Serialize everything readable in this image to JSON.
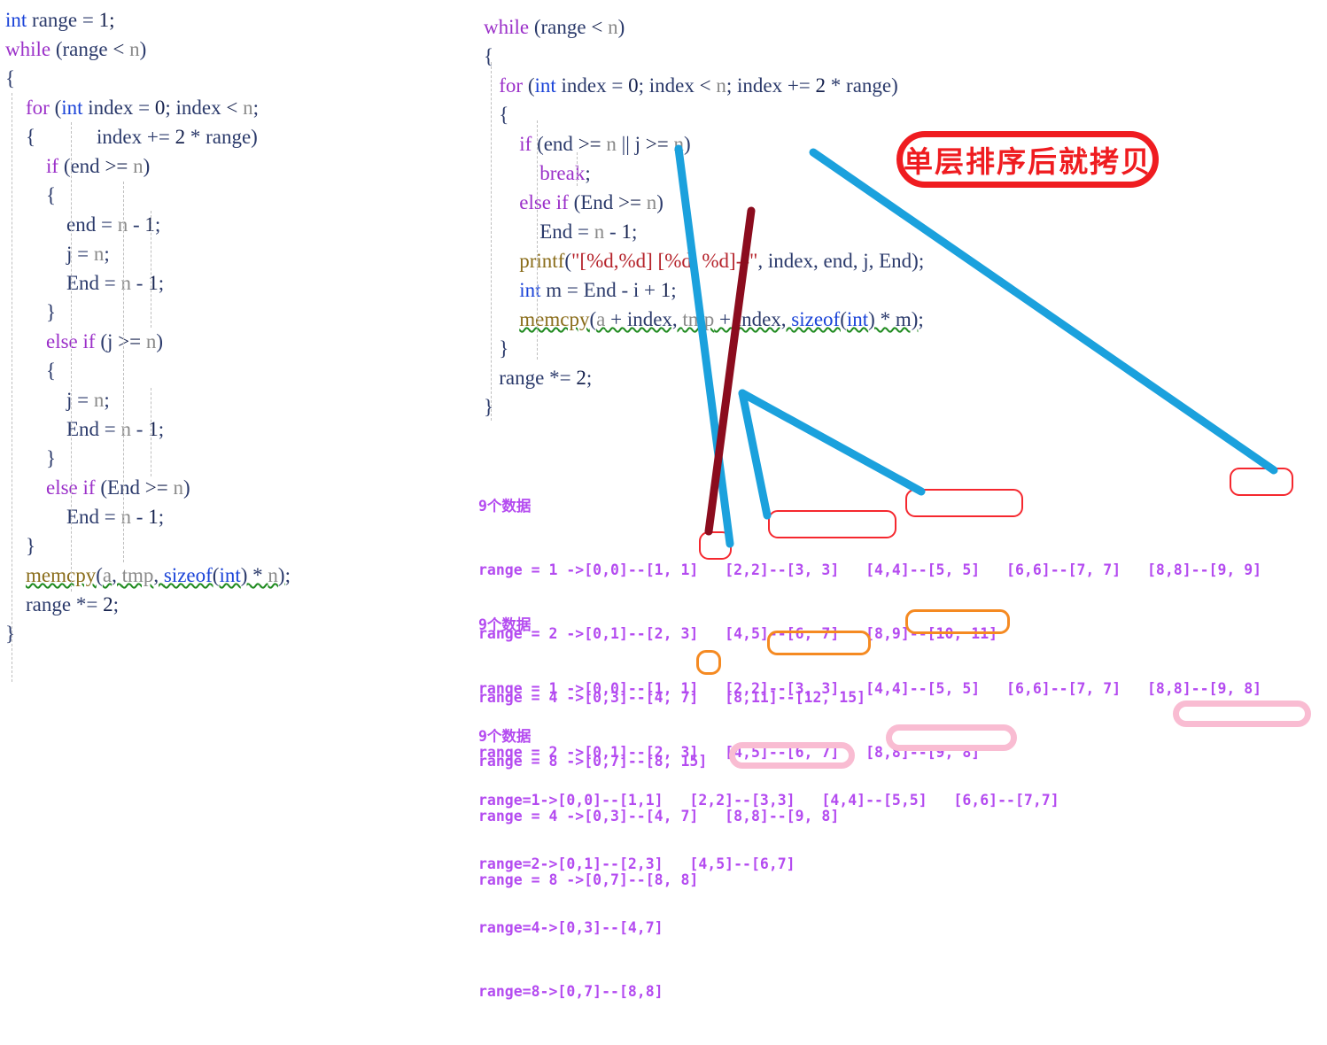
{
  "code_left": {
    "name": "merge-sort-left-snippet",
    "lines": [
      [
        {
          "t": "int",
          "c": "ty"
        },
        {
          "t": " range = ",
          "c": "id"
        },
        {
          "t": "1",
          "c": "num"
        },
        {
          "t": ";",
          "c": "op"
        }
      ],
      [
        {
          "t": "while",
          "c": "kw"
        },
        {
          "t": " (range ",
          "c": "id"
        },
        {
          "t": "<",
          "c": "op"
        },
        {
          "t": " ",
          "c": "id"
        },
        {
          "t": "n",
          "c": "var"
        },
        {
          "t": ")",
          "c": "id"
        }
      ],
      [
        {
          "t": "{",
          "c": "id"
        }
      ],
      [
        {
          "t": "    ",
          "c": "id"
        },
        {
          "t": "for",
          "c": "kw"
        },
        {
          "t": " (",
          "c": "id"
        },
        {
          "t": "int",
          "c": "ty"
        },
        {
          "t": " index = ",
          "c": "id"
        },
        {
          "t": "0",
          "c": "num"
        },
        {
          "t": "; index ",
          "c": "id"
        },
        {
          "t": "<",
          "c": "op"
        },
        {
          "t": " ",
          "c": "id"
        },
        {
          "t": "n",
          "c": "var"
        },
        {
          "t": ";",
          "c": "id"
        }
      ],
      [
        {
          "t": "    {            index += ",
          "c": "id"
        },
        {
          "t": "2",
          "c": "num"
        },
        {
          "t": " * range)",
          "c": "id"
        }
      ],
      [
        {
          "t": "        ",
          "c": "id"
        },
        {
          "t": "if",
          "c": "kw"
        },
        {
          "t": " (end ",
          "c": "id"
        },
        {
          "t": ">=",
          "c": "op"
        },
        {
          "t": " ",
          "c": "id"
        },
        {
          "t": "n",
          "c": "var"
        },
        {
          "t": ")",
          "c": "id"
        }
      ],
      [
        {
          "t": "        {",
          "c": "id"
        }
      ],
      [
        {
          "t": "            end = ",
          "c": "id"
        },
        {
          "t": "n",
          "c": "var"
        },
        {
          "t": " - ",
          "c": "id"
        },
        {
          "t": "1",
          "c": "num"
        },
        {
          "t": ";",
          "c": "id"
        }
      ],
      [
        {
          "t": "            j = ",
          "c": "id"
        },
        {
          "t": "n",
          "c": "var"
        },
        {
          "t": ";",
          "c": "id"
        }
      ],
      [
        {
          "t": "            End = ",
          "c": "id"
        },
        {
          "t": "n",
          "c": "var"
        },
        {
          "t": " - ",
          "c": "id"
        },
        {
          "t": "1",
          "c": "num"
        },
        {
          "t": ";",
          "c": "id"
        }
      ],
      [
        {
          "t": "        }",
          "c": "id"
        }
      ],
      [
        {
          "t": "        ",
          "c": "id"
        },
        {
          "t": "else if",
          "c": "kw"
        },
        {
          "t": " (j ",
          "c": "id"
        },
        {
          "t": ">=",
          "c": "op"
        },
        {
          "t": " ",
          "c": "id"
        },
        {
          "t": "n",
          "c": "var"
        },
        {
          "t": ")",
          "c": "id"
        }
      ],
      [
        {
          "t": "        {",
          "c": "id"
        }
      ],
      [
        {
          "t": "            j = ",
          "c": "id"
        },
        {
          "t": "n",
          "c": "var"
        },
        {
          "t": ";",
          "c": "id"
        }
      ],
      [
        {
          "t": "            End = ",
          "c": "id"
        },
        {
          "t": "n",
          "c": "var"
        },
        {
          "t": " - ",
          "c": "id"
        },
        {
          "t": "1",
          "c": "num"
        },
        {
          "t": ";",
          "c": "id"
        }
      ],
      [
        {
          "t": "        }",
          "c": "id"
        }
      ],
      [
        {
          "t": "        ",
          "c": "id"
        },
        {
          "t": "else if",
          "c": "kw"
        },
        {
          "t": " (End ",
          "c": "id"
        },
        {
          "t": ">=",
          "c": "op"
        },
        {
          "t": " ",
          "c": "id"
        },
        {
          "t": "n",
          "c": "var"
        },
        {
          "t": ")",
          "c": "id"
        }
      ],
      [
        {
          "t": "            End = ",
          "c": "id"
        },
        {
          "t": "n",
          "c": "var"
        },
        {
          "t": " - ",
          "c": "id"
        },
        {
          "t": "1",
          "c": "num"
        },
        {
          "t": ";",
          "c": "id"
        }
      ],
      [
        {
          "t": "    }",
          "c": "id"
        }
      ],
      [
        {
          "t": "    ",
          "c": "id"
        },
        {
          "t": "memcpy",
          "c": "fn squig"
        },
        {
          "t": "(",
          "c": "squig"
        },
        {
          "t": "a",
          "c": "var squig"
        },
        {
          "t": ", ",
          "c": "squig"
        },
        {
          "t": "tmp",
          "c": "var squig"
        },
        {
          "t": ", ",
          "c": "squig"
        },
        {
          "t": "sizeof",
          "c": "ty squig"
        },
        {
          "t": "(",
          "c": "squig"
        },
        {
          "t": "int",
          "c": "ty squig"
        },
        {
          "t": ") * ",
          "c": "squig"
        },
        {
          "t": "n",
          "c": "var squig"
        },
        {
          "t": ")",
          "c": "squig"
        },
        {
          "t": ";",
          "c": "id"
        }
      ],
      [
        {
          "t": "    range *= ",
          "c": "id"
        },
        {
          "t": "2",
          "c": "num"
        },
        {
          "t": ";",
          "c": "id"
        }
      ],
      [
        {
          "t": "}",
          "c": "id"
        }
      ]
    ]
  },
  "code_right": {
    "name": "merge-sort-right-snippet",
    "lines": [
      [
        {
          "t": "while",
          "c": "kw"
        },
        {
          "t": " (range ",
          "c": "id"
        },
        {
          "t": "<",
          "c": "op"
        },
        {
          "t": " ",
          "c": "id"
        },
        {
          "t": "n",
          "c": "var"
        },
        {
          "t": ")",
          "c": "id"
        }
      ],
      [
        {
          "t": "{",
          "c": "id"
        }
      ],
      [
        {
          "t": "   ",
          "c": "id"
        },
        {
          "t": "for",
          "c": "kw"
        },
        {
          "t": " (",
          "c": "id"
        },
        {
          "t": "int",
          "c": "ty"
        },
        {
          "t": " index = ",
          "c": "id"
        },
        {
          "t": "0",
          "c": "num"
        },
        {
          "t": "; index ",
          "c": "id"
        },
        {
          "t": "<",
          "c": "op"
        },
        {
          "t": " ",
          "c": "id"
        },
        {
          "t": "n",
          "c": "var"
        },
        {
          "t": "; index += ",
          "c": "id"
        },
        {
          "t": "2",
          "c": "num"
        },
        {
          "t": " * range)",
          "c": "id"
        }
      ],
      [
        {
          "t": "   {",
          "c": "id"
        }
      ],
      [
        {
          "t": "       ",
          "c": "id"
        },
        {
          "t": "if",
          "c": "kw"
        },
        {
          "t": " (end ",
          "c": "id"
        },
        {
          "t": ">=",
          "c": "op"
        },
        {
          "t": " ",
          "c": "id"
        },
        {
          "t": "n",
          "c": "var"
        },
        {
          "t": " || j ",
          "c": "id"
        },
        {
          "t": ">=",
          "c": "op"
        },
        {
          "t": " ",
          "c": "id"
        },
        {
          "t": "n",
          "c": "var"
        },
        {
          "t": ")",
          "c": "id"
        }
      ],
      [
        {
          "t": "           ",
          "c": "id"
        },
        {
          "t": "break",
          "c": "kw"
        },
        {
          "t": ";",
          "c": "id"
        }
      ],
      [
        {
          "t": "       ",
          "c": "id"
        },
        {
          "t": "else if",
          "c": "kw"
        },
        {
          "t": " (End ",
          "c": "id"
        },
        {
          "t": ">=",
          "c": "op"
        },
        {
          "t": " ",
          "c": "id"
        },
        {
          "t": "n",
          "c": "var"
        },
        {
          "t": ")",
          "c": "id"
        }
      ],
      [
        {
          "t": "           End = ",
          "c": "id"
        },
        {
          "t": "n",
          "c": "var"
        },
        {
          "t": " - ",
          "c": "id"
        },
        {
          "t": "1",
          "c": "num"
        },
        {
          "t": ";",
          "c": "id"
        }
      ],
      [
        {
          "t": "       ",
          "c": "id"
        },
        {
          "t": "printf",
          "c": "fn"
        },
        {
          "t": "(",
          "c": "id"
        },
        {
          "t": "\"[%d,%d] [%d, %d]--\"",
          "c": "str"
        },
        {
          "t": ", index, end, j, End)",
          "c": "id"
        },
        {
          "t": ";",
          "c": "id"
        }
      ],
      [
        {
          "t": "       ",
          "c": "id"
        },
        {
          "t": "int",
          "c": "ty"
        },
        {
          "t": " m = End - i + ",
          "c": "id"
        },
        {
          "t": "1",
          "c": "num"
        },
        {
          "t": ";",
          "c": "id"
        }
      ],
      [
        {
          "t": "       ",
          "c": "id"
        },
        {
          "t": "memcpy",
          "c": "fn squig"
        },
        {
          "t": "(",
          "c": "squig"
        },
        {
          "t": "a",
          "c": "var squig"
        },
        {
          "t": " + index, ",
          "c": "squig"
        },
        {
          "t": "tmp",
          "c": "var squig"
        },
        {
          "t": " + index, ",
          "c": "squig"
        },
        {
          "t": "sizeof",
          "c": "ty squig"
        },
        {
          "t": "(",
          "c": "squig"
        },
        {
          "t": "int",
          "c": "ty squig"
        },
        {
          "t": ") * m)",
          "c": "squig"
        },
        {
          "t": ";",
          "c": "id"
        }
      ],
      [
        {
          "t": "   }",
          "c": "id"
        }
      ],
      [
        {
          "t": "   range *= ",
          "c": "id"
        },
        {
          "t": "2",
          "c": "num"
        },
        {
          "t": ";",
          "c": "id"
        }
      ],
      [
        {
          "t": "}",
          "c": "id"
        }
      ]
    ]
  },
  "annotation": {
    "chinese_note": "单层排序后就拷贝",
    "note_color": "#ef1c20"
  },
  "output_blocks": [
    {
      "id": "block-1",
      "header": "9个数据",
      "rows": [
        "range = 1 ->[0,0]--[1, 1]   [2,2]--[3, 3]   [4,4]--[5, 5]   [6,6]--[7, 7]   [8,8]--[9, 9]",
        "range = 2 ->[0,1]--[2, 3]   [4,5]--[6, 7]   [8,9]--[10, 11]",
        "range = 4 ->[0,3]--[4, 7]   [8,11]--[12, 15]",
        "range = 8 ->[0,7]--[8, 15]"
      ],
      "highlight_color": "#f5282f"
    },
    {
      "id": "block-2",
      "header": "9个数据",
      "rows": [
        "range = 1 ->[0,0]--[1, 1]   [2,2]--[3, 3]   [4,4]--[5, 5]   [6,6]--[7, 7]   [8,8]--[9, 8]",
        "range = 2 ->[0,1]--[2, 3]   [4,5]--[6, 7]   [8,8]--[9, 8]",
        "range = 4 ->[0,3]--[4, 7]   [8,8]--[9, 8]",
        "range = 8 ->[0,7]--[8, 8]"
      ],
      "highlight_color": "#f58a22"
    },
    {
      "id": "block-3",
      "header": "9个数据",
      "rows": [
        "range=1->[0,0]--[1,1]   [2,2]--[3,3]   [4,4]--[5,5]   [6,6]--[7,7]",
        "range=2->[0,1]--[2,3]   [4,5]--[6,7]",
        "range=4->[0,3]--[4,7]",
        "range=8->[0,7]--[8,8]"
      ],
      "highlight_color": "#f9bcd2"
    }
  ],
  "connectors": {
    "blue_color": "#1ba1dd",
    "darkred_color": "#8b0c1e"
  }
}
